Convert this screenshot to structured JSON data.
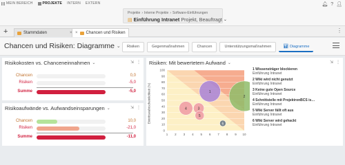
{
  "topnav": {
    "items": [
      {
        "label": "MEIN BEREICH",
        "active": false
      },
      {
        "label": "PROJEKTE",
        "active": true
      },
      {
        "label": "INTERN",
        "active": false
      },
      {
        "label": "EXTERN",
        "active": false
      }
    ]
  },
  "breadcrumb": {
    "items": [
      "Projekte",
      "Interne Projekte",
      "Software-Einführungen"
    ]
  },
  "project": {
    "name": "Einführung Intranet",
    "suffix": "Projekt, Beauftragt"
  },
  "tabs": {
    "new": "+",
    "items": [
      {
        "label": "Stammdaten"
      },
      {
        "label": "Chancen und Risiken"
      }
    ]
  },
  "page": {
    "title": "Chancen und Risiken: Diagramme"
  },
  "navtabs": [
    "Risiken",
    "Gegenmaßnahmen",
    "Chancen",
    "Unterstützungsmaßnahmen",
    "Diagramme"
  ],
  "widget1": {
    "title": "Risikokosten vs. Chanceneinnahmen",
    "rows": [
      {
        "label": "Chancen",
        "value": "0,0",
        "fraction": 0.0,
        "color": "#e7b07a"
      },
      {
        "label": "Risiken",
        "value": "-5,0",
        "fraction": 0.0,
        "color": "#d33a4e"
      },
      {
        "label": "Summe",
        "value": "-5,0",
        "fraction": 1.0,
        "color": "#d1203f"
      }
    ]
  },
  "widget2": {
    "title": "Risikoaufwände vs. Aufwandseinsparungen",
    "rows": [
      {
        "label": "Chancen",
        "value": "10,0",
        "fraction": 0.3,
        "color": "#b5e39a"
      },
      {
        "label": "Risiken",
        "value": "-21,0",
        "fraction": 0.62,
        "color": "#f0a58c"
      },
      {
        "label": "Summe",
        "value": "-11,0",
        "fraction": 1.0,
        "color": "#d1203f"
      }
    ]
  },
  "widget3": {
    "title": "Risiken: Mit bewertetem Aufwand"
  },
  "chart_data": {
    "type": "scatter",
    "title": "Risiken: Mit bewertetem Aufwand",
    "ylabel": "Eintrittswahrscheinlichkeit (%)",
    "xlabel": "",
    "x_ticks": [
      "1",
      "2",
      "3",
      "4",
      "5",
      "6",
      "7",
      "8",
      "9",
      "10"
    ],
    "y_ticks": [
      "0",
      "10",
      "20",
      "30",
      "40",
      "50",
      "60",
      "70",
      "80",
      "90",
      "100"
    ],
    "xlim": [
      1,
      10
    ],
    "ylim": [
      0,
      100
    ],
    "points": [
      {
        "id": "1",
        "x": 6,
        "y": 65,
        "r": 7,
        "color": "#a884d8"
      },
      {
        "id": "2",
        "x": 10,
        "y": 57,
        "r": 10,
        "color": "#8fbc6a"
      },
      {
        "id": "3",
        "x": 4.7,
        "y": 37,
        "r": 3.5,
        "color": "#ef9aa3"
      },
      {
        "id": "4",
        "x": 3.2,
        "y": 37,
        "r": 4.5,
        "color": "#ef9aa3"
      },
      {
        "id": "5",
        "x": 4.8,
        "y": 25,
        "r": 3,
        "color": "#ef9aa3"
      },
      {
        "id": "6",
        "x": 7.5,
        "y": 12,
        "r": 2,
        "color": "#607080"
      }
    ]
  },
  "legend": [
    {
      "title": "1 Wissensträger blockieren",
      "sub": "Einführung Intranet"
    },
    {
      "title": "2 Wiki wird nicht genutzt",
      "sub": "Einführung Intranet"
    },
    {
      "title": "3 Keine gute Open Source",
      "sub": "Einführung Intranet"
    },
    {
      "title": "4 Schnittstelle mit ProjektronBCS is…",
      "sub": "Einführung Intranet"
    },
    {
      "title": "5 Wiki Server fällt oft aus",
      "sub": "Einführung Intranet"
    },
    {
      "title": "6 Wiki Server wird gehackt",
      "sub": "Einführung Intranet"
    }
  ]
}
